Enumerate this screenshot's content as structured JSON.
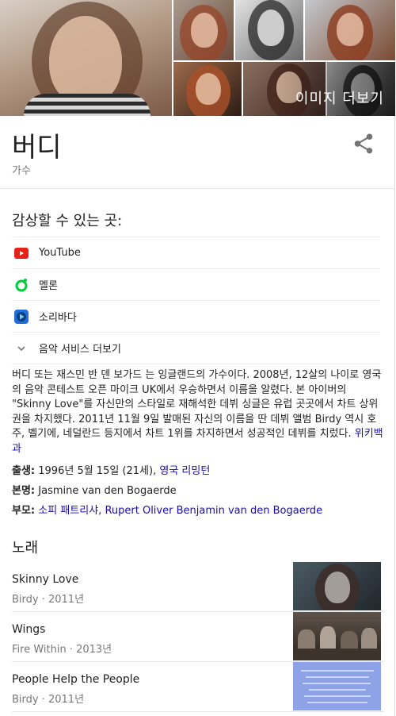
{
  "images": {
    "more_label": "이미지 더보기"
  },
  "entity": {
    "title": "버디",
    "subtitle": "가수"
  },
  "listen": {
    "heading": "감상할 수 있는 곳:",
    "services": [
      {
        "label": "YouTube",
        "icon": "youtube-icon"
      },
      {
        "label": "멜론",
        "icon": "melon-icon"
      },
      {
        "label": "소리바다",
        "icon": "soribada-icon"
      },
      {
        "label": "음악 서비스 더보기",
        "icon": "chevron-down-icon"
      }
    ]
  },
  "description": {
    "text": "버디 또는 재스민 반 덴 보가드 는 잉글랜드의 가수이다. 2008년, 12살의 나이로 영국의 음악 콘테스트 오픈 마이크 UK에서 우승하면서 이름을 알렸다. 본 아이버의 \"Skinny Love\"를 자신만의 스타일로 재해석한 데뷔 싱글은 유럽 곳곳에서 차트 상위권을 차지했다. 2011년 11월 9일 발매된 자신의 이름을 딴 데뷔 앨범 Birdy 역시 호주, 벨기에, 네덜란드 등지에서 차트 1위를 차지하면서 성공적인 데뷔를 치렀다.",
    "source_link": "위키백과"
  },
  "facts": {
    "born_label": "출생:",
    "born_value": "1996년 5월 15일 (21세),",
    "born_place": "영국 리밍턴",
    "realname_label": "본명:",
    "realname_value": "Jasmine van den Bogaerde",
    "parents_label": "부모:",
    "parent1": "소피 패트리샤",
    "parent_sep": ",",
    "parent2": "Rupert Oliver Benjamin van den Bogaerde"
  },
  "songs": {
    "heading": "노래",
    "items": [
      {
        "title": "Skinny Love",
        "meta": "Birdy · 2011년"
      },
      {
        "title": "Wings",
        "meta": "Fire Within · 2013년"
      },
      {
        "title": "People Help the People",
        "meta": "Birdy · 2011년"
      }
    ]
  },
  "colors": {
    "link": "#1a0dab",
    "youtube_red": "#e62117",
    "melon_green": "#00cd3c",
    "soribada_blue": "#1e6fd9"
  }
}
